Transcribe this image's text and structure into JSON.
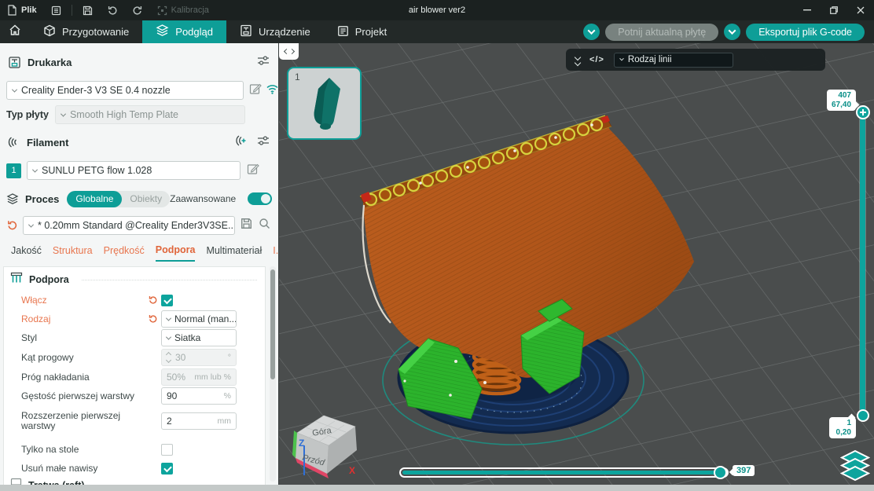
{
  "titlebar": {
    "file": "Plik",
    "calibration": "Kalibracja",
    "title": "air blower ver2"
  },
  "navbar": {
    "tabs": [
      {
        "label": "Przygotowanie"
      },
      {
        "label": "Podgląd"
      },
      {
        "label": "Urządzenie"
      },
      {
        "label": "Projekt"
      }
    ],
    "slice_button": "Potnij aktualną płytę",
    "export_button": "Eksportuj plik G-code"
  },
  "printer": {
    "title": "Drukarka",
    "name": "Creality Ender-3 V3 SE 0.4 nozzle",
    "plate_label": "Typ płyty",
    "plate_value": "Smooth High Temp Plate"
  },
  "filament": {
    "title": "Filament",
    "slot": "1",
    "value": "SUNLU PETG flow 1.028"
  },
  "process": {
    "title": "Proces",
    "scope_global": "Globalne",
    "scope_objects": "Obiekty",
    "advanced": "Zaawansowane",
    "preset": "* 0.20mm Standard @Creality Ender3V3SE..."
  },
  "setting_tabs": {
    "t0": "Jakość",
    "t1": "Struktura",
    "t2": "Prędkość",
    "t3": "Podpora",
    "t4": "Multimateriał",
    "t5": "I..."
  },
  "support": {
    "title": "Podpora",
    "enable_label": "Włącz",
    "type_label": "Rodzaj",
    "type_value": "Normal (man...",
    "style_label": "Styl",
    "style_value": "Siatka",
    "angle_label": "Kąt progowy",
    "angle_value": "30",
    "angle_unit": "°",
    "overlap_label": "Próg nakładania",
    "overlap_value": "50%",
    "overlap_unit": "mm lub %",
    "density_label": "Gęstość pierwszej warstwy",
    "density_value": "90",
    "density_unit": "%",
    "expansion_label": "Rozszerzenie pierwszej warstwy",
    "expansion_value": "2",
    "expansion_unit": "mm",
    "buildplate_only_label": "Tylko na stole",
    "remove_overhangs_label": "Usuń małe nawisy",
    "raft_title": "Tratwa (raft)"
  },
  "viewport": {
    "plate_number": "1",
    "line_type": "Rodzaj linii",
    "layer_slider": {
      "top_layer": "407",
      "top_height": "67,40",
      "bottom_layer": "1",
      "bottom_height": "0,20"
    },
    "step_slider_value": "397",
    "cube": {
      "top": "Góra",
      "front": "Przód",
      "x": "X",
      "z": "Z"
    }
  },
  "colors": {
    "accent": "#0e9e97",
    "modified": "#e8764f",
    "model_body": "#b2571a",
    "support": "#2cb32c",
    "raft": "#132b50"
  }
}
